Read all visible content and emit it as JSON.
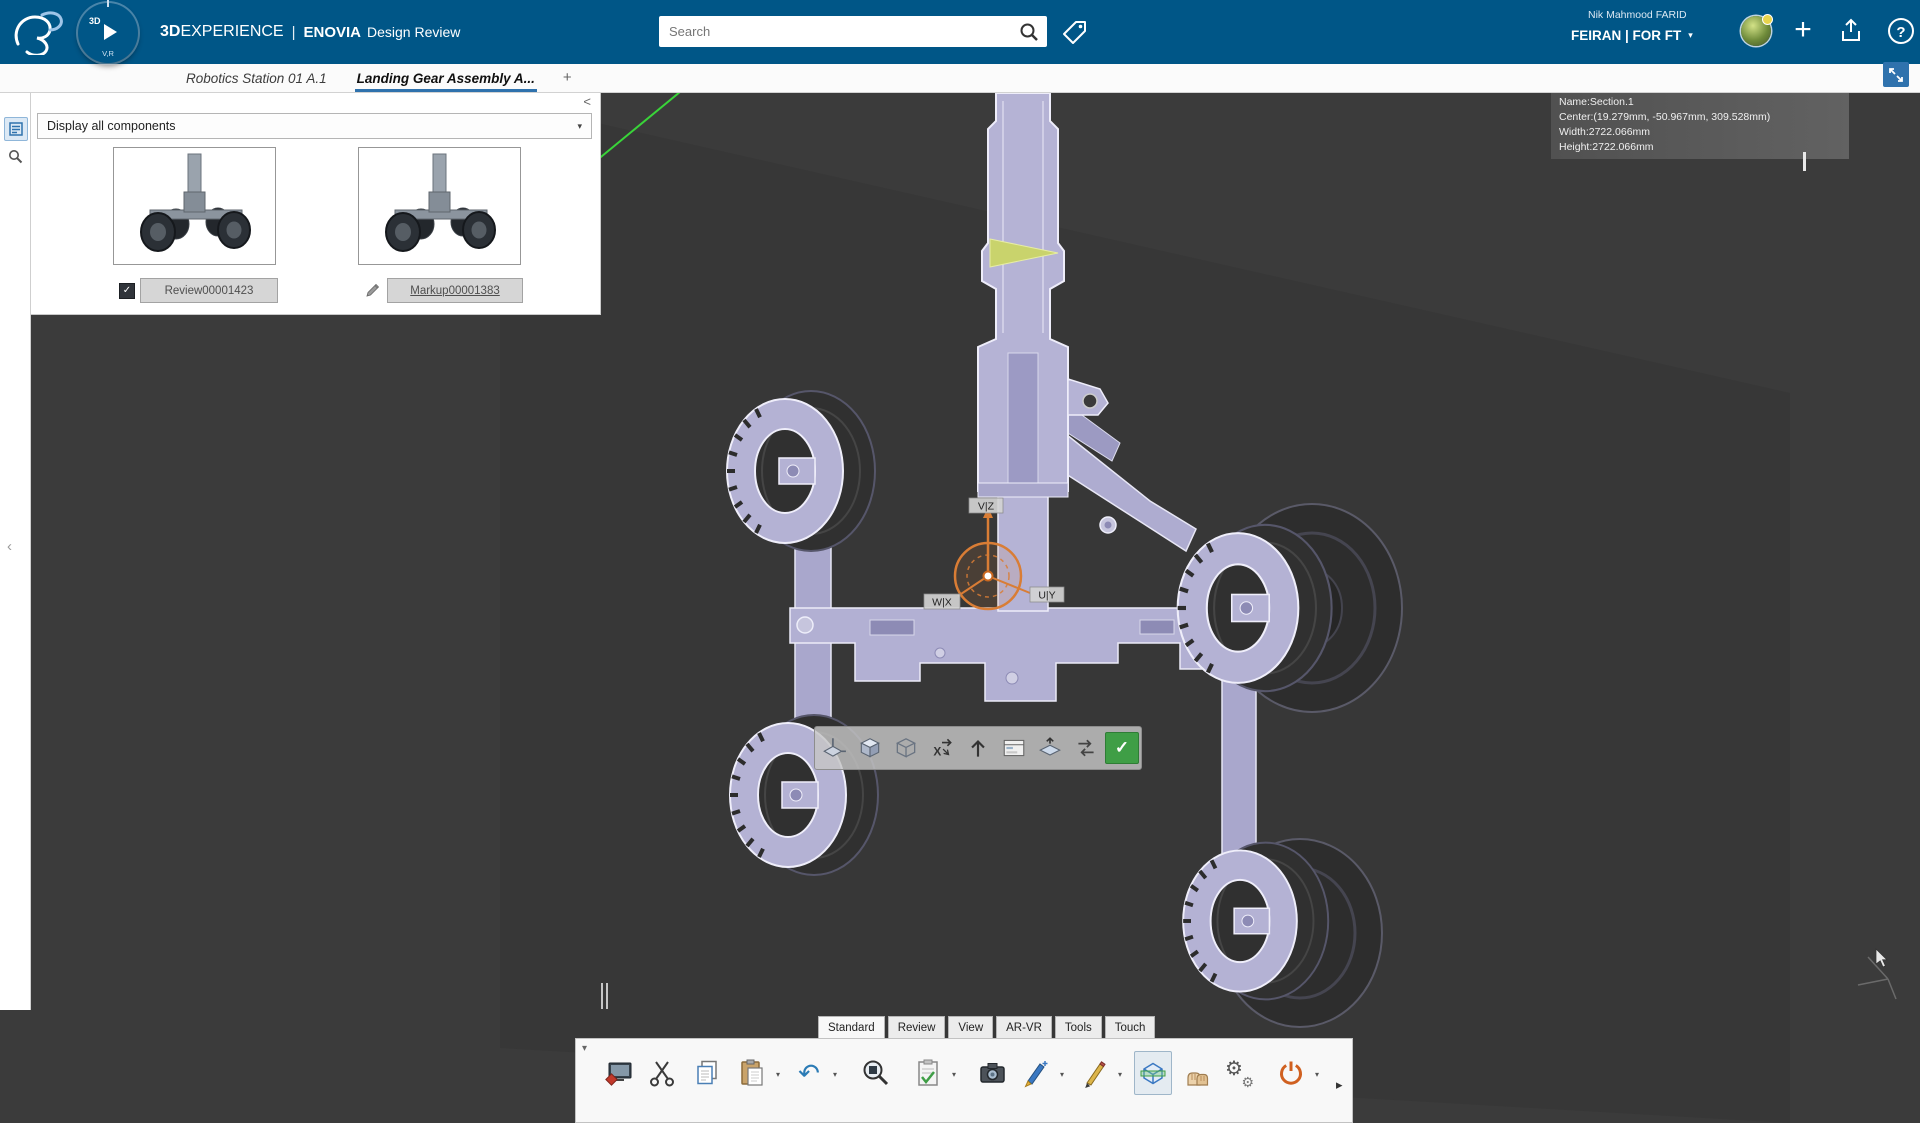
{
  "colors": {
    "topbar_blue": "#005687",
    "accent_blue": "#2f72ad",
    "ok_green": "#3f9e46",
    "manipulator_orange": "#d97d35",
    "section_lavender": "#b4b2d4"
  },
  "topbar": {
    "brand_bold": "3D",
    "brand_rest": "EXPERIENCE",
    "brand_divider": "|",
    "app_bold": "ENOVIA",
    "app_name": "Design Review",
    "compass_top": "3D",
    "compass_bottom": "V,R",
    "search_placeholder": "Search",
    "user_name": "Nik  Mahmood FARID",
    "tenant_label": "FEIRAN | FOR FT",
    "tenant_caret": "▾",
    "plus_glyph": "+"
  },
  "doc_tabs": {
    "tabs": [
      {
        "label": "Robotics Station 01 A.1",
        "active": false
      },
      {
        "label": "Landing Gear Assembly A...",
        "active": true
      }
    ],
    "add_label": "+"
  },
  "left_panel": {
    "collapse_glyph": "<",
    "strip_collapse_glyph": "‹",
    "dropdown_value": "Display all components",
    "dropdown_caret": "▾",
    "thumbnails": [
      {
        "label": "Review00001423",
        "kind": "review",
        "checked": true,
        "check_glyph": "✓"
      },
      {
        "label": "Markup00001383",
        "kind": "markup"
      }
    ]
  },
  "viewport": {
    "section_info": {
      "name": "Name:Section.1",
      "center": "Center:(19.279mm, -50.967mm, 309.528mm)",
      "width": "Width:2722.066mm",
      "height": "Height:2722.066mm"
    },
    "robot_labels": {
      "vz": "V|Z",
      "wx": "W|X",
      "uy": "U|Y"
    },
    "section_toolbar": [
      "section-corner",
      "section-cube",
      "section-cube-wire",
      "section-axis",
      "section-arrow-up",
      "section-panel",
      "section-plane-move",
      "section-flip",
      "section-ok"
    ],
    "section_ok_glyph": "✓"
  },
  "action_bar": {
    "tabs": [
      {
        "label": "Standard",
        "active": true
      },
      {
        "label": "Review",
        "active": false
      },
      {
        "label": "View",
        "active": false
      },
      {
        "label": "AR-VR",
        "active": false
      },
      {
        "label": "Tools",
        "active": false
      },
      {
        "label": "Touch",
        "active": false
      }
    ],
    "tools": [
      {
        "name": "screen-paste",
        "dropdown": false
      },
      {
        "name": "cut",
        "dropdown": false
      },
      {
        "name": "copy",
        "dropdown": false
      },
      {
        "name": "paste",
        "dropdown": true
      },
      {
        "name": "undo",
        "dropdown": true
      },
      {
        "name": "zoom",
        "dropdown": false
      },
      {
        "name": "approvals",
        "dropdown": true
      },
      {
        "name": "camera",
        "dropdown": false
      },
      {
        "name": "marker",
        "dropdown": true
      },
      {
        "name": "pen",
        "dropdown": true
      },
      {
        "name": "clipping",
        "dropdown": false,
        "active": true
      },
      {
        "name": "manipulate",
        "dropdown": false
      },
      {
        "name": "settings-gears",
        "dropdown": false
      },
      {
        "name": "power",
        "dropdown": true
      }
    ],
    "collapse_glyph": "▾",
    "more_glyph": "▸",
    "dropdown_caret": "▾"
  }
}
